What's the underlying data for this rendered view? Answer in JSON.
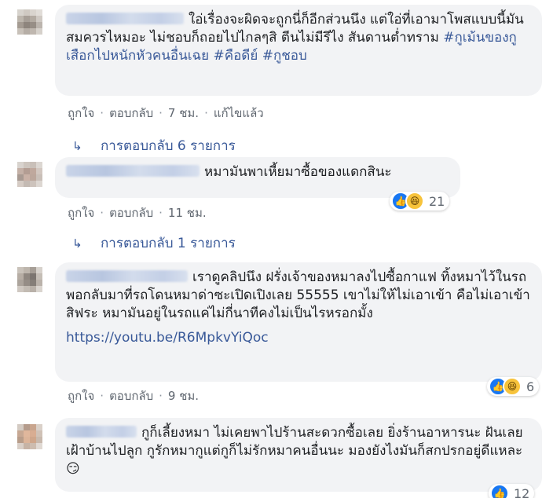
{
  "colors": {
    "bubble_bg": "#f2f3f5",
    "link": "#385898",
    "meta_text": "#606770",
    "like_blue": "#1877f2",
    "haha_yellow": "#f7c33b"
  },
  "actions": {
    "like": "ถูกใจ",
    "reply": "ตอบกลับ",
    "separator": "·"
  },
  "comments": [
    {
      "text": "ใอ่เรื่องจะผิดจะถูกนี่ก็อีกส่วนนึง แต่ใอ่ที่เอามาโพสแบบนี้มันสมควรไหมอะ ไม่ชอบก็ถอยไปไกลๆสิ ตีนไม่มีรึไง สันดานต่ำทราม",
      "hashtags": [
        "#กูเม้นของกูเสือกไปหนักหัวคนอื่นเฉย",
        "#คือดีย์",
        "#กูชอบ"
      ],
      "time": "7 ชม.",
      "edited": "แก้ไขแล้ว",
      "replies_label": "การตอบกลับ 6 รายการ",
      "avatar_icon": "avatar-icon"
    },
    {
      "text": "หมามันพาเหี้ยมาซื้อของแดกสินะ",
      "time": "11 ชม.",
      "reaction_count": "21",
      "replies_label": "การตอบกลับ 1 รายการ",
      "avatar_icon": "avatar-icon"
    },
    {
      "text": "เราดูคลิปนึง ฝรั่งเจ้าของหมาลงไปซื้อกาแฟ ทิ้งหมาไว้ในรถ พอกลับมาที่รถโดนหมาด่าซะเปิดเปิงเลย 55555 เขาไม่ให้ไม่เอาเข้า คือไม่เอาเข้าสิฟระ หมามันอยู่ในรถแค่ไม่กี่นาทีคงไม่เป็นไรหรอกมั้ง",
      "link": "https://youtu.be/R6MpkvYiQoc",
      "time": "9 ชม.",
      "reaction_count": "6",
      "avatar_icon": "avatar-icon"
    },
    {
      "text": "กูก็เลี้ยงหมา ไม่เคยพาไปร้านสะดวกซื้อเลย ยิ่งร้านอาหารนะ ฝันเลย เฝ้าบ้านไปลูก กูรักหมากูแต่กูก็ไม่รักหมาคนอื่นนะ มองยังไงมันก็สกปรกอยู่ดีแหละ 😏",
      "reaction_count": "12",
      "avatar_icon": "avatar-icon"
    }
  ]
}
